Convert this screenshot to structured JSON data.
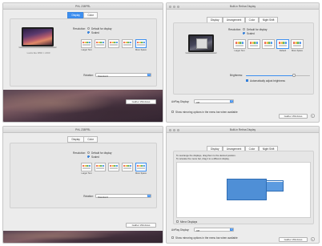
{
  "window_top_left": {
    "title": "PHL 238PRL",
    "tabs": [
      "Display",
      "Color"
    ],
    "selected_tab": "Display",
    "resolution_label": "Resolution:",
    "resolution_options": [
      "Default for display",
      "Scaled"
    ],
    "selected_resolution": "Scaled",
    "scale_options": [
      "Larger Text",
      "",
      "",
      "",
      "More Space"
    ],
    "selected_scale_index": 4,
    "screen_caption": "Looks like 3840 × 2160",
    "rotation_label": "Rotation:",
    "rotation_value": "Standard",
    "gather_button": "Gather Windows"
  },
  "window_top_right": {
    "title": "Built-in Retina Display",
    "tabs": [
      "Display",
      "Arrangement",
      "Color",
      "Night Shift"
    ],
    "selected_tab": "Display",
    "resolution_label": "Resolution:",
    "resolution_options": [
      "Default for display",
      "Scaled"
    ],
    "selected_resolution": "Scaled",
    "scale_options": [
      "Larger Text",
      "",
      "",
      "Default",
      "More Space"
    ],
    "selected_scale_index": 3,
    "brightness_label": "Brightness:",
    "brightness_level": 0.75,
    "auto_brightness_label": "Automatically adjust brightness",
    "auto_brightness_checked": true,
    "airplay_label": "AirPlay Display:",
    "airplay_value": "Off",
    "mirroring_label": "Show mirroring options in the menu bar when available",
    "gather_button": "Gather Windows",
    "help_icon": "?"
  },
  "window_bottom_left": {
    "title": "PHL 238PRL",
    "tabs": [
      "Display",
      "Color"
    ],
    "selected_tab": "Display",
    "resolution_label": "Resolution:",
    "resolution_options": [
      "Default for display",
      "Scaled"
    ],
    "selected_resolution": "Scaled",
    "scale_options": [
      "Larger Text",
      "",
      "",
      "",
      "More Space"
    ],
    "selected_scale_index": 4,
    "rotation_label": "Rotation:",
    "rotation_value": "Standard",
    "gather_button": "Gather Windows"
  },
  "window_bottom_right": {
    "title": "Built-in Retina Display",
    "tabs": [
      "Display",
      "Arrangement",
      "Color",
      "Night Shift"
    ],
    "selected_tab": "Arrangement",
    "instructions_line1": "To rearrange the displays, drag them to the desired position.",
    "instructions_line2": "To relocate the menu bar, drag it to a different display.",
    "mirror_label": "Mirror Displays",
    "mirror_checked": false,
    "airplay_label": "AirPlay Display:",
    "airplay_value": "Off",
    "mirroring_label": "Show mirroring options in the menu bar when available",
    "gather_button": "Gather Windows",
    "help_icon": "?"
  },
  "colors": {
    "accent": "#3d8ff0",
    "window_bg": "#ececec",
    "arrangement_display": "#4f8fd6"
  },
  "icons": [
    "window-close-icon",
    "window-minimize-icon",
    "window-zoom-icon",
    "chevron-updown-icon",
    "help-icon",
    "laptop-icon"
  ]
}
